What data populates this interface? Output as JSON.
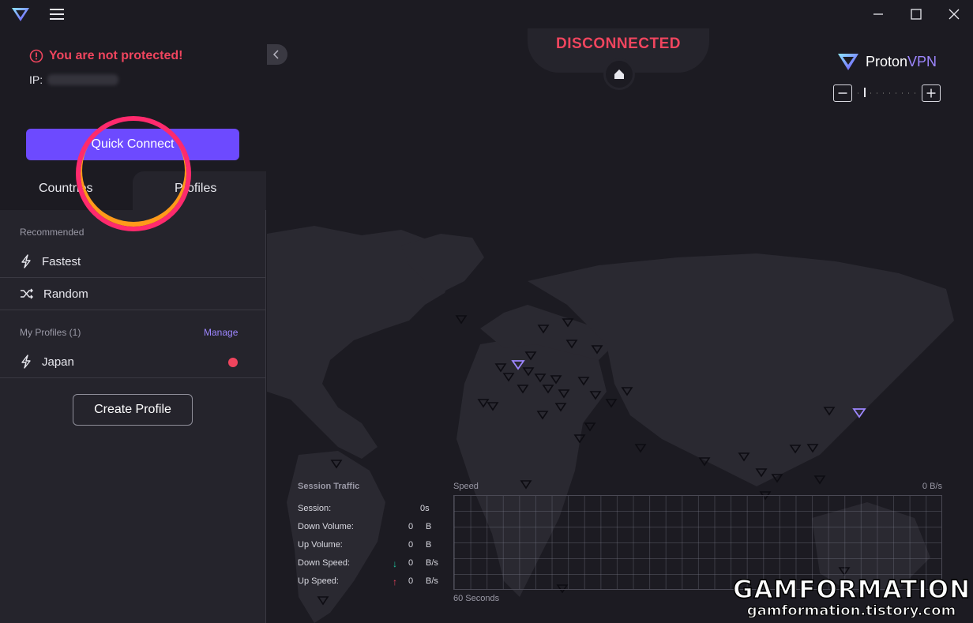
{
  "titlebar": {
    "minimize_icon": "minimize-icon",
    "maximize_icon": "maximize-icon",
    "close_icon": "close-icon"
  },
  "sidebar": {
    "warning": "You are not protected!",
    "ip_label": "IP:",
    "quick_connect": "Quick Connect",
    "tabs": [
      "Countries",
      "Profiles"
    ],
    "recommended_label": "Recommended",
    "recommended": [
      {
        "label": "Fastest",
        "icon": "bolt-icon"
      },
      {
        "label": "Random",
        "icon": "shuffle-icon"
      }
    ],
    "profiles_label": "My Profiles (1)",
    "manage": "Manage",
    "profiles": [
      {
        "label": "Japan",
        "icon": "bolt-icon",
        "color": "#f0455e"
      }
    ],
    "create_profile": "Create Profile"
  },
  "main": {
    "status": "DISCONNECTED",
    "brand": {
      "proton": "Proton",
      "vpn": "VPN"
    },
    "traffic": {
      "title": "Session Traffic",
      "rows": [
        {
          "label": "Session:",
          "value": "0s",
          "unit": ""
        },
        {
          "label": "Down Volume:",
          "value": "0",
          "unit": "B"
        },
        {
          "label": "Up Volume:",
          "value": "0",
          "unit": "B"
        },
        {
          "label": "Down Speed:",
          "value": "0",
          "unit": "B/s"
        },
        {
          "label": "Up Speed:",
          "value": "0",
          "unit": "B/s"
        }
      ]
    },
    "speed": {
      "label": "Speed",
      "value": "0 B/s",
      "window": "60 Seconds"
    }
  },
  "watermark": {
    "line1": "GAMFORMATION",
    "line2": "gamformation.tistory.com"
  },
  "colors": {
    "accent": "#6d4aff",
    "danger": "#f0455e",
    "background": "#1c1b22",
    "panel": "#25242c"
  }
}
